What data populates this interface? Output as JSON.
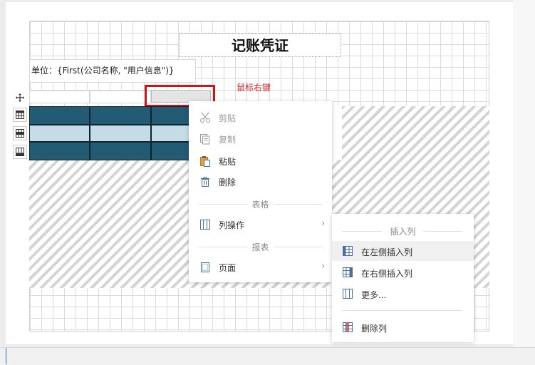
{
  "report": {
    "title": "记账凭证",
    "unit_text": "单位：{First(公司名称, \"用户信息\")}",
    "hint_text": "鼠标右键"
  },
  "context_menu": {
    "cut": "剪贴",
    "copy": "复制",
    "paste": "粘贴",
    "delete": "删除",
    "section_table": "表格",
    "column_ops": "列操作",
    "section_report": "报表",
    "page": "页面",
    "arrow": "›"
  },
  "submenu": {
    "section_insert": "插入列",
    "insert_left": "在左侧插入列",
    "insert_right": "在右侧插入列",
    "more": "更多...",
    "delete_column": "删除列"
  },
  "colors": {
    "table_dark": "#235a74",
    "table_light": "#c5dce6",
    "highlight_red": "#d0121b",
    "hint_red": "#d12323"
  },
  "icons": [
    "move-icon",
    "table-icon",
    "table-header-icon",
    "table-footer-icon",
    "scissors-icon",
    "copy-icon",
    "paste-icon",
    "trash-icon",
    "columns-icon",
    "page-icon",
    "insert-column-left-icon",
    "insert-column-right-icon",
    "more-columns-icon",
    "delete-column-icon"
  ]
}
